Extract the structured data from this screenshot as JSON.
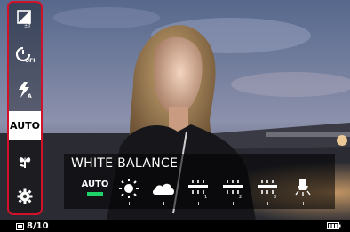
{
  "sidebar": {
    "items": [
      {
        "icon": "exposure-comp-icon",
        "label": ""
      },
      {
        "icon": "self-timer-off-icon",
        "label": ""
      },
      {
        "icon": "flash-auto-icon",
        "label": ""
      },
      {
        "icon": "",
        "label": "AUTO"
      },
      {
        "icon": "macro-flower-icon",
        "label": ""
      },
      {
        "icon": "gear-icon",
        "label": ""
      }
    ],
    "frame_color": "#d2112a"
  },
  "white_balance": {
    "title": "WHITE BALANCE",
    "selected": "AUTO",
    "options": [
      {
        "icon": "",
        "label": "AUTO"
      },
      {
        "icon": "daylight-icon",
        "label": ""
      },
      {
        "icon": "cloudy-icon",
        "label": ""
      },
      {
        "icon": "fluorescent-1-icon",
        "label": ""
      },
      {
        "icon": "fluorescent-2-icon",
        "label": ""
      },
      {
        "icon": "fluorescent-3-icon",
        "label": ""
      },
      {
        "icon": "incandescent-icon",
        "label": ""
      }
    ],
    "accent_color": "#1fd36a"
  },
  "status": {
    "shot_count": "8/10",
    "icons": [
      "memory-card-icon",
      "battery-icon"
    ]
  }
}
